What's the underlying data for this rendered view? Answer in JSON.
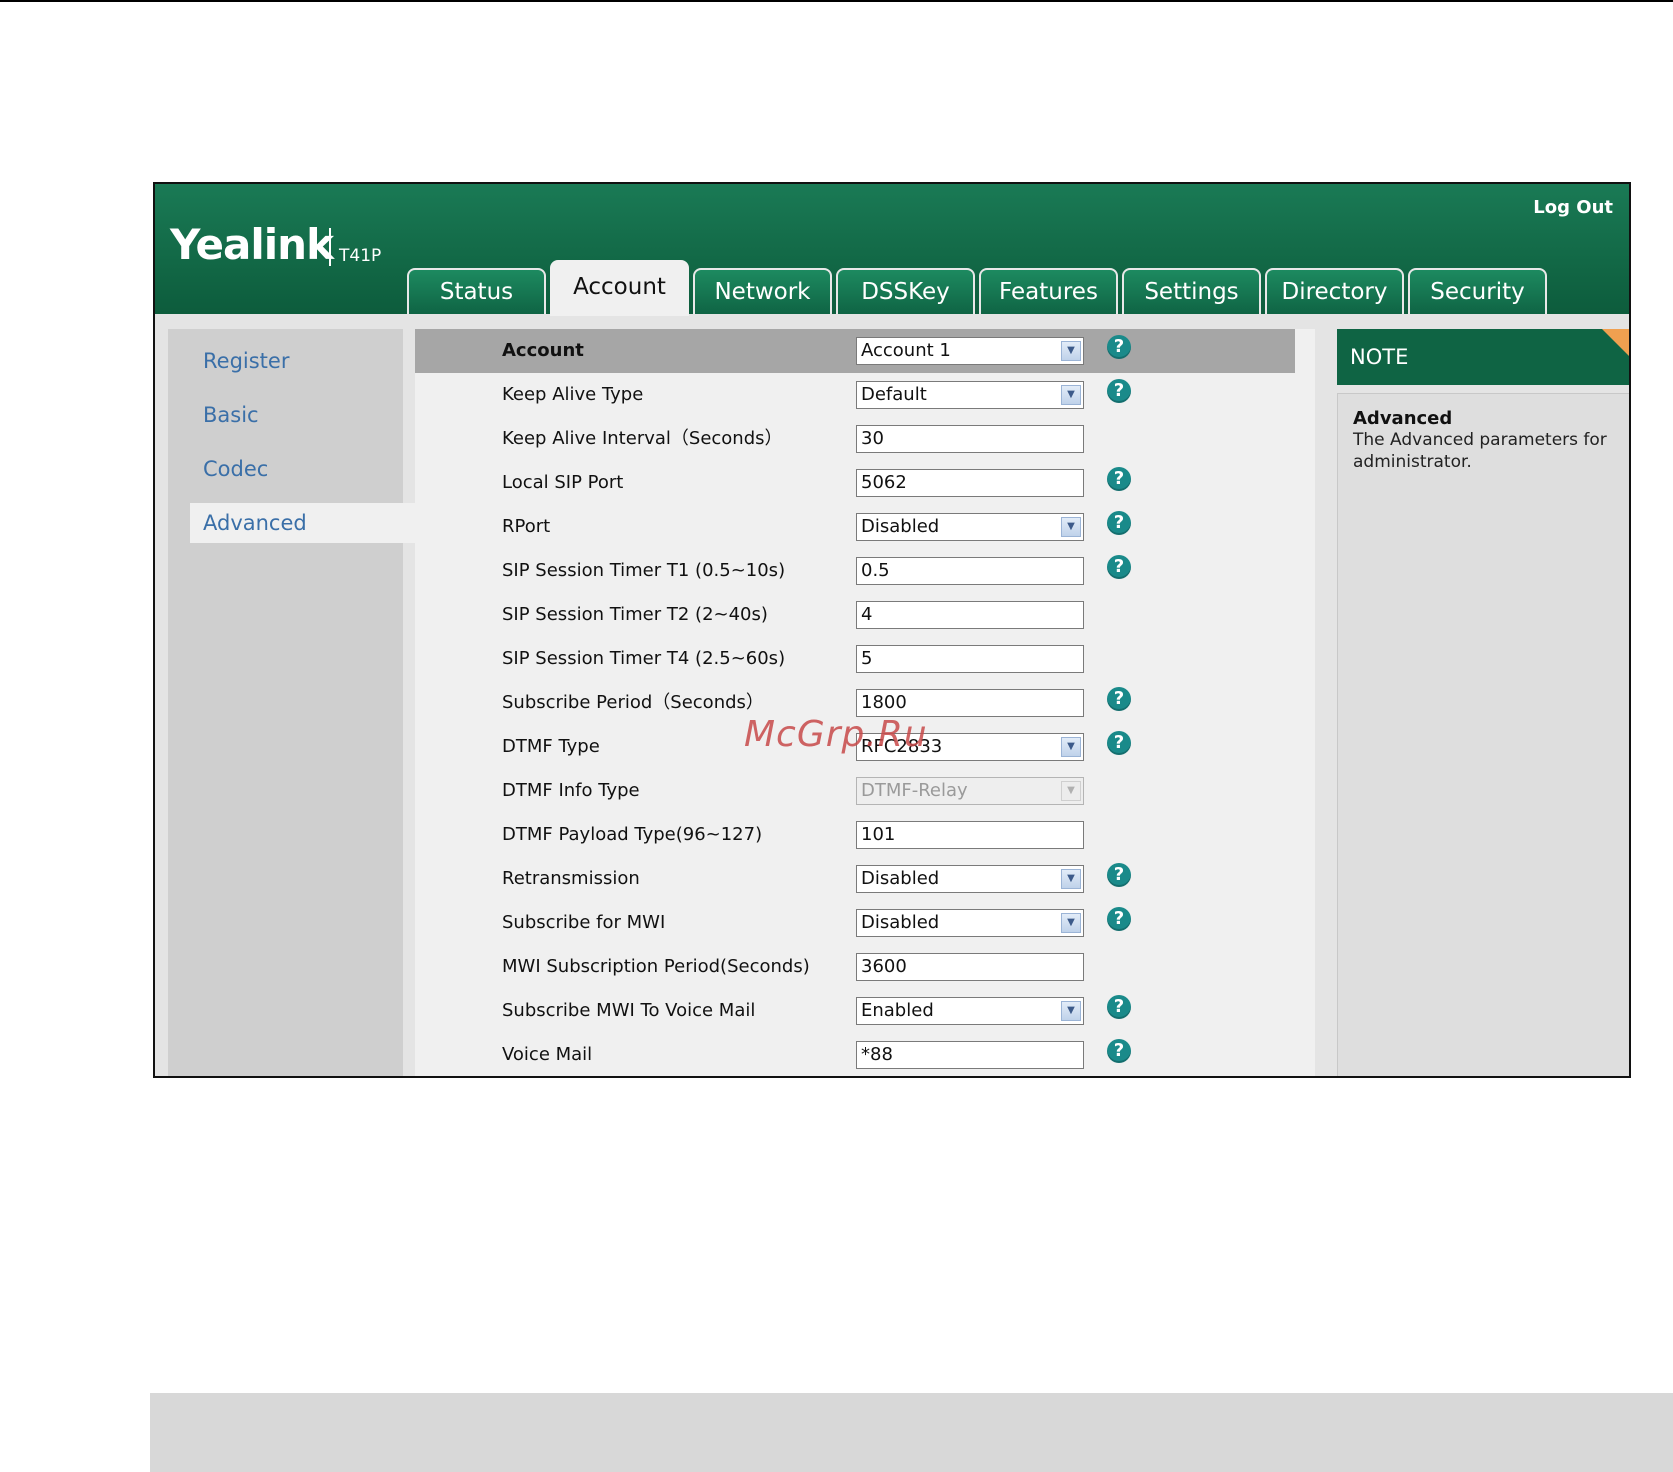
{
  "header": {
    "brand": "Yealink",
    "model": "T41P",
    "logout_label": "Log Out",
    "colors": {
      "header_green": "#126846",
      "link_blue": "#3a6fa8",
      "help_teal": "#1a8a8a",
      "note_corner": "#f0a050"
    }
  },
  "tabs": [
    {
      "label": "Status"
    },
    {
      "label": "Account",
      "active": true
    },
    {
      "label": "Network"
    },
    {
      "label": "DSSKey"
    },
    {
      "label": "Features"
    },
    {
      "label": "Settings"
    },
    {
      "label": "Directory"
    },
    {
      "label": "Security"
    }
  ],
  "sidebar": {
    "items": [
      {
        "label": "Register"
      },
      {
        "label": "Basic"
      },
      {
        "label": "Codec"
      },
      {
        "label": "Advanced",
        "active": true
      }
    ]
  },
  "form": {
    "header": {
      "label": "Account",
      "value": "Account 1"
    },
    "rows": [
      {
        "label": "Keep Alive Type",
        "value": "Default"
      },
      {
        "label": "Keep Alive Interval（Seconds）",
        "value": "30"
      },
      {
        "label": "Local SIP Port",
        "value": "5062"
      },
      {
        "label": "RPort",
        "value": "Disabled"
      },
      {
        "label": "SIP Session Timer T1 (0.5~10s)",
        "value": "0.5"
      },
      {
        "label": "SIP Session Timer T2 (2~40s)",
        "value": "4"
      },
      {
        "label": "SIP Session Timer T4 (2.5~60s)",
        "value": "5"
      },
      {
        "label": "Subscribe Period（Seconds）",
        "value": "1800"
      },
      {
        "label": "DTMF Type",
        "value": "RFC2833"
      },
      {
        "label": "DTMF Info Type",
        "value": "DTMF-Relay"
      },
      {
        "label": "DTMF Payload Type(96~127)",
        "value": "101"
      },
      {
        "label": "Retransmission",
        "value": "Disabled"
      },
      {
        "label": "Subscribe for MWI",
        "value": "Disabled"
      },
      {
        "label": "MWI Subscription Period(Seconds)",
        "value": "3600"
      },
      {
        "label": "Subscribe MWI To Voice Mail",
        "value": "Enabled"
      },
      {
        "label": "Voice Mail",
        "value": "*88"
      }
    ],
    "help_symbol": "?"
  },
  "note": {
    "heading": "NOTE",
    "title": "Advanced",
    "text": "The Advanced parameters for administrator."
  },
  "watermark": "McGrp.Ru"
}
